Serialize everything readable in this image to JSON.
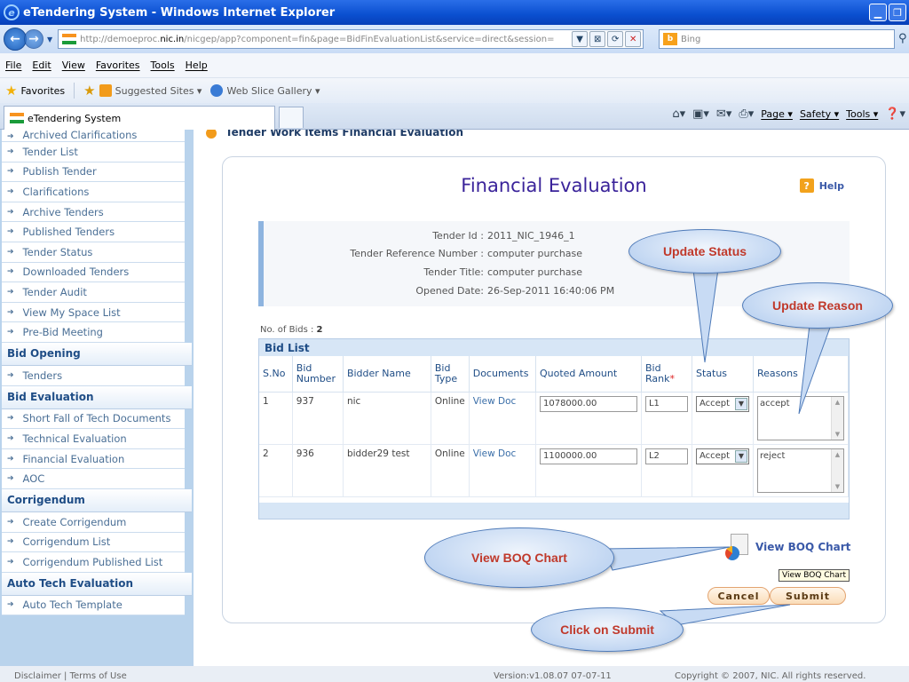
{
  "window": {
    "title": "eTendering System - Windows Internet Explorer",
    "min_label": "▁",
    "max_label": "❐"
  },
  "address": {
    "url_prefix": "http://demoeproc.",
    "url_domain": "nic.in",
    "url_rest": "/nicgep/app?component=fin&page=BidFinEvaluationList&service=direct&session=",
    "search_placeholder": "Bing"
  },
  "menu": [
    "File",
    "Edit",
    "View",
    "Favorites",
    "Tools",
    "Help"
  ],
  "favorites": {
    "label": "Favorites",
    "items": [
      "Suggested Sites ▾",
      "Web Slice Gallery ▾"
    ]
  },
  "tab": {
    "title": "eTendering System",
    "commands": [
      "Page ▾",
      "Safety ▾",
      "Tools ▾"
    ]
  },
  "sidebar": {
    "top_items": [
      "Archived Clarifications",
      "Tender List",
      "Publish Tender",
      "Clarifications",
      "Archive Tenders",
      "Published Tenders",
      "Tender Status",
      "Downloaded Tenders",
      "Tender Audit",
      "View My Space List",
      "Pre-Bid Meeting"
    ],
    "bid_opening": {
      "title": "Bid Opening",
      "items": [
        "Tenders"
      ]
    },
    "bid_evaluation": {
      "title": "Bid Evaluation",
      "items": [
        "Short Fall of Tech Documents",
        "Technical Evaluation",
        "Financial Evaluation",
        "AOC"
      ]
    },
    "corrigendum": {
      "title": "Corrigendum",
      "items": [
        "Create Corrigendum",
        "Corrigendum List",
        "Corrigendum Published List"
      ]
    },
    "auto_tech": {
      "title": "Auto Tech Evaluation",
      "items": [
        "Auto Tech Template"
      ]
    }
  },
  "breadcrumb": "Tender Work Items Financial Evaluation",
  "main": {
    "title": "Financial Evaluation",
    "help": "Help",
    "tender_info": [
      {
        "label": "Tender Id :",
        "value": "2011_NIC_1946_1"
      },
      {
        "label": "Tender Reference Number :",
        "value": "computer purchase"
      },
      {
        "label": "Tender Title:",
        "value": "computer purchase"
      },
      {
        "label": "Opened Date:",
        "value": "26-Sep-2011 16:40:06 PM"
      }
    ],
    "bid_count_label": "No. of Bids :",
    "bid_count": "2",
    "bid_list_title": "Bid List",
    "columns": [
      "S.No",
      "Bid Number",
      "Bidder Name",
      "Bid Type",
      "Documents",
      "Quoted Amount",
      "Bid Rank",
      "Status",
      "Reasons"
    ],
    "rank_required_mark": "*",
    "rows": [
      {
        "sno": "1",
        "bid_number": "937",
        "bidder": "nic",
        "type": "Online",
        "documents": "View Doc",
        "amount": "1078000.00",
        "rank": "L1",
        "status": "Accept",
        "reason": "accept"
      },
      {
        "sno": "2",
        "bid_number": "936",
        "bidder": "bidder29 test",
        "type": "Online",
        "documents": "View Doc",
        "amount": "1100000.00",
        "rank": "L2",
        "status": "Accept",
        "reason": "reject"
      }
    ],
    "boq_link": "View BOQ Chart",
    "boq_tooltip": "View BOQ Chart",
    "cancel": "Cancel",
    "submit": "Submit"
  },
  "footer": {
    "links": "Disclaimer  |  Terms of Use",
    "version": "Version:v1.08.07 07-07-11",
    "copyright": "Copyright © 2007, NIC. All rights reserved."
  },
  "callouts": {
    "update_status": "Update Status",
    "update_reason": "Update Reason",
    "view_boq": "View BOQ Chart",
    "click_submit": "Click on Submit"
  }
}
